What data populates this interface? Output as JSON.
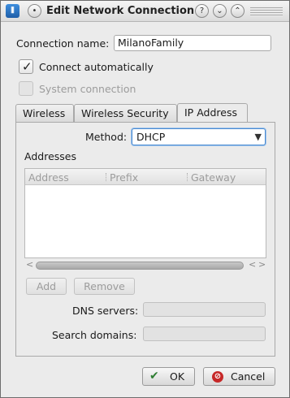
{
  "window": {
    "title": "Edit Network Connection",
    "app_icon": "network-manager-icon",
    "titlebar_buttons": [
      "help",
      "menu",
      "minimize",
      "maximize"
    ]
  },
  "connection": {
    "name_label": "Connection name:",
    "name_value": "MilanoFamily",
    "auto_connect_label": "Connect automatically",
    "auto_connect_checked": true,
    "system_connection_label": "System connection",
    "system_connection_checked": false
  },
  "tabs": [
    {
      "label": "Wireless",
      "active": false
    },
    {
      "label": "Wireless Security",
      "active": false
    },
    {
      "label": "IP Address",
      "active": true
    }
  ],
  "ip_panel": {
    "method_label": "Method:",
    "method_value": "DHCP",
    "addresses_label": "Addresses",
    "columns": [
      "Address",
      "Prefix",
      "Gateway"
    ],
    "rows": [],
    "add_label": "Add",
    "remove_label": "Remove",
    "dns_label": "DNS servers:",
    "dns_value": "",
    "search_label": "Search domains:",
    "search_value": ""
  },
  "dialog_buttons": {
    "ok_label": "OK",
    "cancel_label": "Cancel"
  }
}
